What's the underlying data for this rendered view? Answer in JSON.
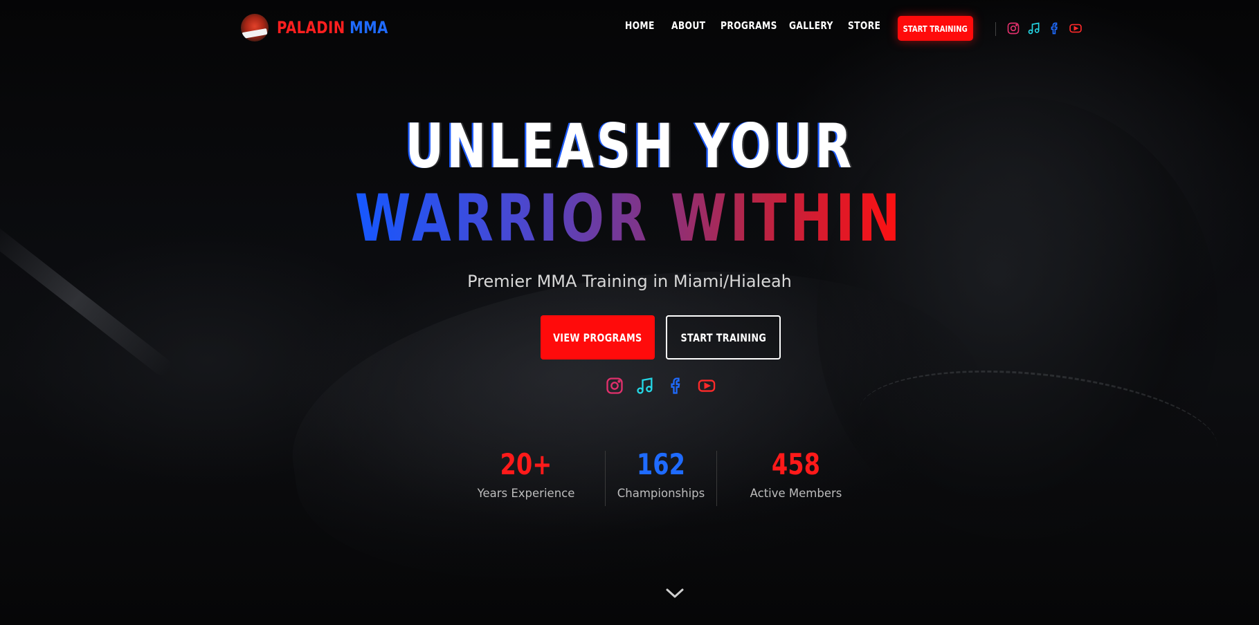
{
  "brand": {
    "part1": "PALADIN",
    "part2": "MMA",
    "logo_text": "PALADIN"
  },
  "nav": {
    "items": [
      {
        "label": "HOME"
      },
      {
        "label": "ABOUT"
      },
      {
        "label": "PROGRAMS"
      },
      {
        "label": "GALLERY"
      },
      {
        "label": "STORE"
      }
    ],
    "cta_label": "START TRAINING"
  },
  "social": [
    {
      "icon": "instagram-icon",
      "color": "#e1306c"
    },
    {
      "icon": "tiktok-music-icon",
      "color": "#25d7e6"
    },
    {
      "icon": "facebook-icon",
      "color": "#1f6bff"
    },
    {
      "icon": "youtube-icon",
      "color": "#ff2a2a"
    }
  ],
  "hero": {
    "line1": "UNLEASH YOUR",
    "line2": "WARRIOR WITHIN",
    "subtitle": "Premier MMA Training in Miami/Hialeah",
    "primary_button": "VIEW PROGRAMS",
    "secondary_button": "START TRAINING"
  },
  "stats": [
    {
      "value": "20+",
      "label": "Years Experience",
      "color": "#ff1a1a"
    },
    {
      "value": "162",
      "label": "Championships",
      "color": "#1f6bff"
    },
    {
      "value": "458",
      "label": "Active Members",
      "color": "#ff1a1a"
    }
  ],
  "colors": {
    "accent_red": "#ff0b0b",
    "accent_blue": "#1f6bff",
    "background": "#060607"
  }
}
